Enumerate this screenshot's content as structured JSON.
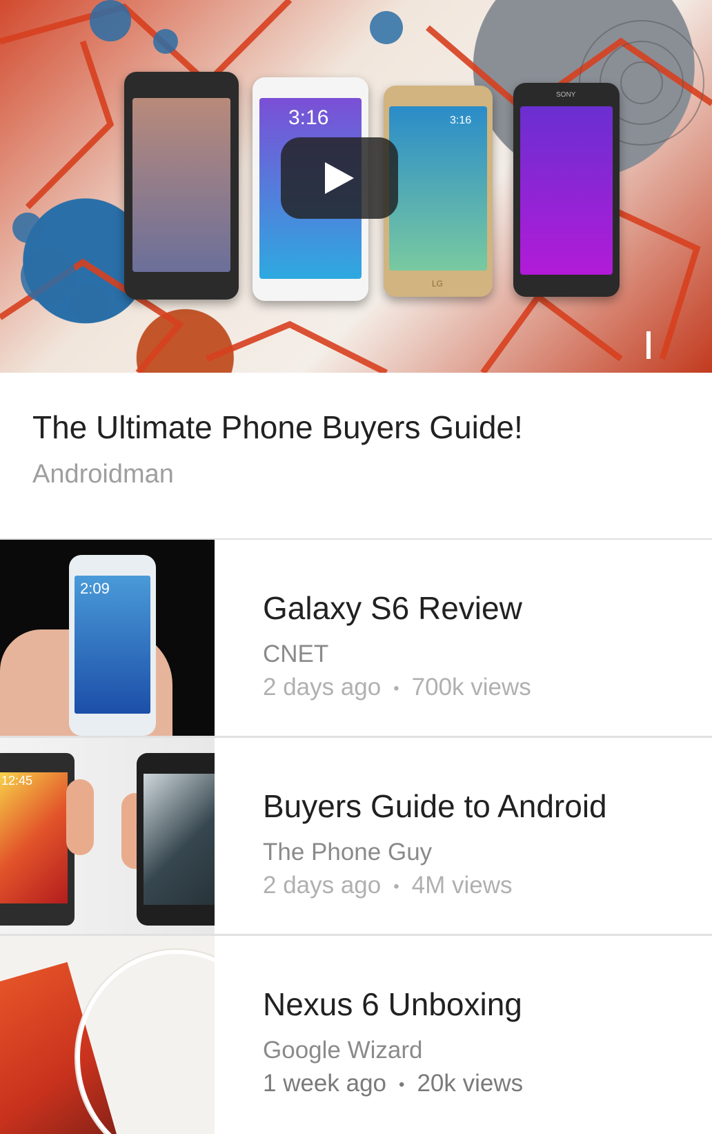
{
  "featured": {
    "title": "The Ultimate Phone Buyers Guide!",
    "channel": "Androidman",
    "phones": [
      {
        "time": "",
        "brand": ""
      },
      {
        "time": "3:16",
        "brand": ""
      },
      {
        "time": "3:16",
        "brand": "LG"
      },
      {
        "time": "",
        "brand": "SONY"
      }
    ]
  },
  "videos": [
    {
      "title": "Galaxy S6 Review",
      "channel": "CNET",
      "age": "2 days ago",
      "views": "700k views",
      "thumb_time": "2:09"
    },
    {
      "title": "Buyers Guide to Android",
      "channel": "The Phone Guy",
      "age": "2 days ago",
      "views": "4M views",
      "thumb_time": "12:45"
    },
    {
      "title": "Nexus 6 Unboxing",
      "channel": "Google Wizard",
      "age": "1 week ago",
      "views": "20k views",
      "thumb_time": ""
    }
  ],
  "meta_separator": "•",
  "icons": {
    "play": "play-icon"
  },
  "colors": {
    "accent_red": "#d23c23",
    "text_primary": "#212121",
    "text_secondary": "#9e9e9e"
  }
}
